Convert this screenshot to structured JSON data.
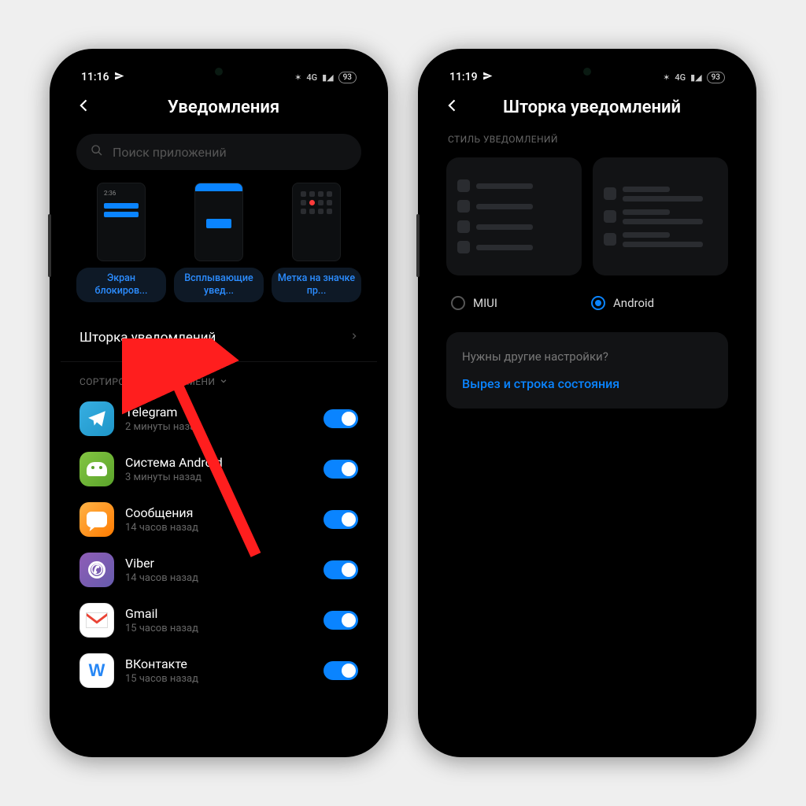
{
  "phone1": {
    "status": {
      "time": "11:16",
      "battery": "93"
    },
    "header": {
      "title": "Уведомления"
    },
    "search": {
      "placeholder": "Поиск приложений"
    },
    "cards": {
      "lockscreen": "Экран блокиров...",
      "floating": "Всплывающие увед...",
      "badge": "Метка на значке пр..."
    },
    "shade_row": {
      "label": "Шторка уведомлений"
    },
    "sort_label": "СОРТИРОВАТЬ ПО ВРЕМЕНИ",
    "apps": [
      {
        "name": "Telegram",
        "sub": "2 минуты назад",
        "icon": "telegram"
      },
      {
        "name": "Система Android",
        "sub": "3 минуты назад",
        "icon": "android"
      },
      {
        "name": "Сообщения",
        "sub": "14 часов назад",
        "icon": "messages"
      },
      {
        "name": "Viber",
        "sub": "14 часов назад",
        "icon": "viber"
      },
      {
        "name": "Gmail",
        "sub": "15 часов назад",
        "icon": "gmail"
      },
      {
        "name": "ВКонтакте",
        "sub": "15 часов назад",
        "icon": "vk"
      }
    ]
  },
  "phone2": {
    "status": {
      "time": "11:19",
      "battery": "93"
    },
    "header": {
      "title": "Шторка уведомлений"
    },
    "section": "СТИЛЬ УВЕДОМЛЕНИЙ",
    "radio": {
      "miui": "MIUI",
      "android": "Android",
      "selected": "android"
    },
    "info": {
      "question": "Нужны другие настройки?",
      "link": "Вырез и строка состояния"
    }
  },
  "status_icons": {
    "net": "4G",
    "signal": "⁴",
    "bt": "✱"
  }
}
